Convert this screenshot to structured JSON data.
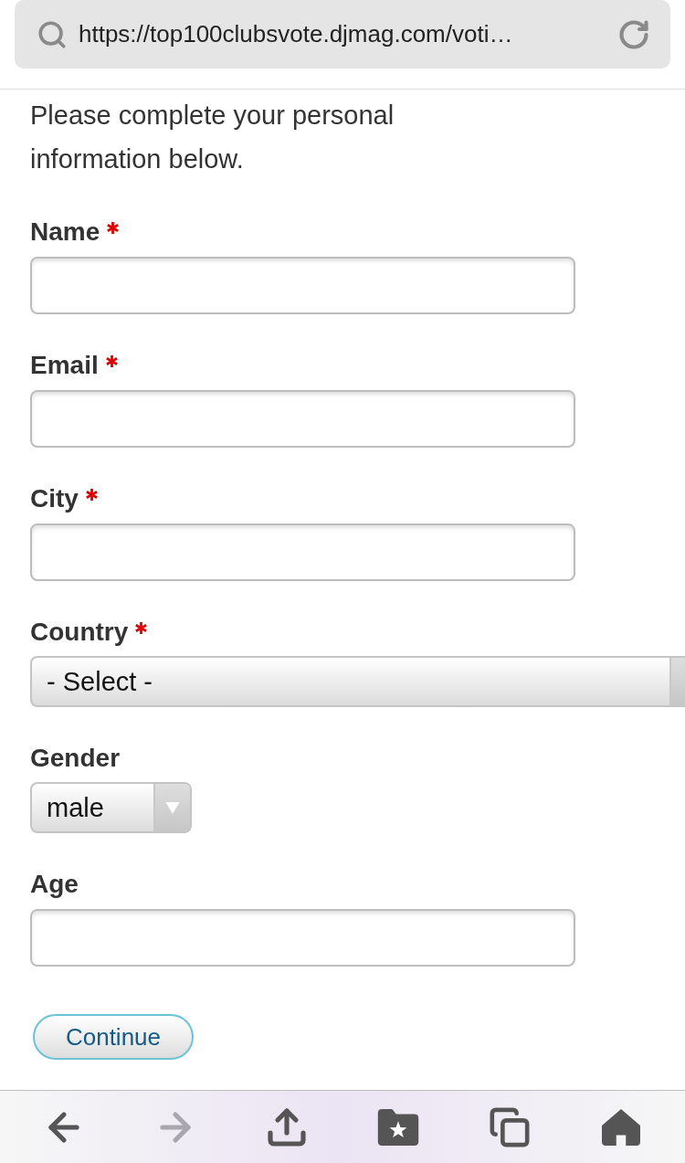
{
  "browser": {
    "url": "https://top100clubsvote.djmag.com/voti…"
  },
  "intro": "Please complete your personal information below.",
  "fields": [
    {
      "kind": "text",
      "label": "Name",
      "required": true
    },
    {
      "kind": "text",
      "label": "Email",
      "required": true
    },
    {
      "kind": "text",
      "label": "City",
      "required": true
    },
    {
      "kind": "wide_select",
      "label": "Country",
      "required": true,
      "value": "- Select -"
    },
    {
      "kind": "select",
      "label": "Gender",
      "required": false,
      "value": "male"
    },
    {
      "kind": "text",
      "label": "Age",
      "required": false
    }
  ],
  "submit": {
    "label": "Continue"
  },
  "toolbar": [
    {
      "kind": "back",
      "disabled": false
    },
    {
      "kind": "forward",
      "disabled": true
    },
    {
      "kind": "share",
      "disabled": false
    },
    {
      "kind": "bookmarks",
      "disabled": false
    },
    {
      "kind": "tabs",
      "disabled": false
    },
    {
      "kind": "home",
      "disabled": false
    }
  ]
}
